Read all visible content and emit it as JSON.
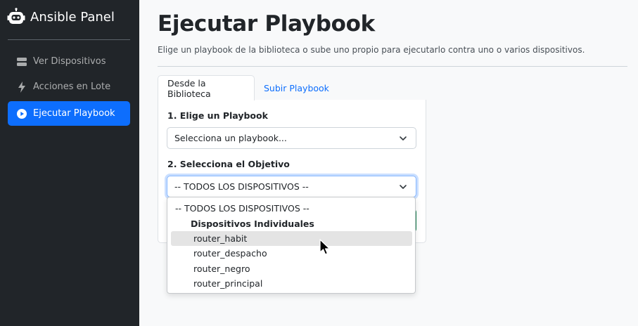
{
  "sidebar": {
    "brand": "Ansible Panel",
    "items": [
      {
        "label": "Ver Dispositivos",
        "icon": "database-icon"
      },
      {
        "label": "Acciones en Lote",
        "icon": "lightning-icon"
      },
      {
        "label": "Ejecutar Playbook",
        "icon": "play-circle-icon",
        "active": true
      }
    ]
  },
  "main": {
    "title": "Ejecutar Playbook",
    "subtitle": "Elige un playbook de la biblioteca o sube uno propio para ejecutarlo contra uno o varios dispositivos.",
    "tabs": [
      {
        "label": "Desde la Biblioteca",
        "active": true
      },
      {
        "label": "Subir Playbook",
        "active": false
      }
    ],
    "form": {
      "playbook_label": "1. Elige un Playbook",
      "playbook_value": "Selecciona un playbook...",
      "target_label": "2. Selecciona el Objetivo",
      "target_value": "-- TODOS LOS DISPOSITIVOS --"
    },
    "dropdown": {
      "all_option": "-- TODOS LOS DISPOSITIVOS --",
      "group_label": "Dispositivos Individuales",
      "options": [
        "router_habit",
        "router_despacho",
        "router_negro",
        "router_principal"
      ],
      "highlighted": "router_habit"
    }
  },
  "colors": {
    "sidebar_bg": "#212529",
    "accent": "#0d6efd",
    "success": "#198754"
  }
}
